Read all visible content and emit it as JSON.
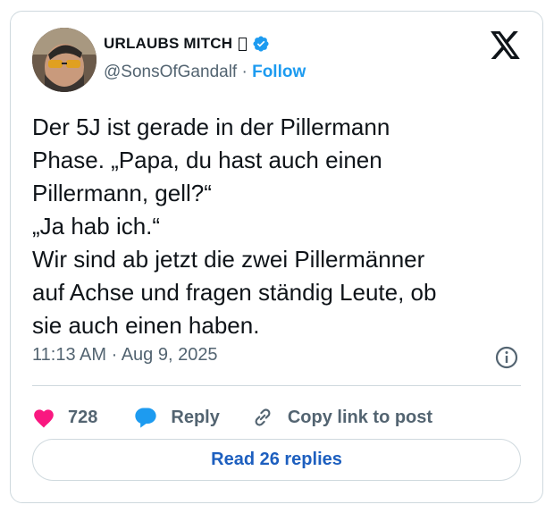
{
  "author": {
    "display_name": "URLAUBS MITCH",
    "handle": "@SonsOfGandalf",
    "separator": "·",
    "follow_label": "Follow",
    "verified": true
  },
  "tweet": {
    "text": "Der 5J ist gerade in der Pillermann\nPhase. „Papa, du hast auch einen\nPillermann, gell?“\n„Ja hab ich.“\nWir sind ab jetzt die zwei Pillermänner\nauf Achse und fragen ständig Leute, ob\nsie auch einen haben.",
    "timestamp": "11:13 AM · Aug 9, 2025"
  },
  "actions": {
    "like_count": "728",
    "reply_label": "Reply",
    "copy_link_label": "Copy link to post"
  },
  "read_replies_label": "Read 26 replies",
  "colors": {
    "accent": "#1d9bf0",
    "like": "#f91880",
    "secondary_text": "#536471",
    "border": "#cfd9de"
  },
  "icons": [
    "verified-badge-icon",
    "x-logo-icon",
    "info-icon",
    "heart-icon",
    "reply-bubble-icon",
    "link-icon"
  ]
}
